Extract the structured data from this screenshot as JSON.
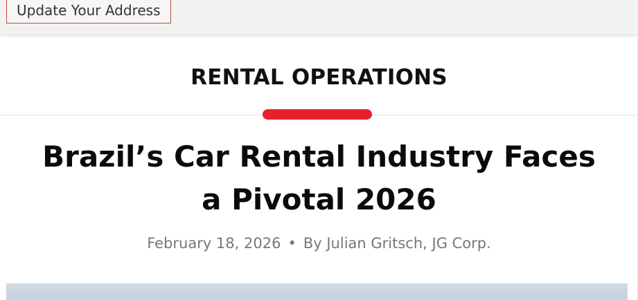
{
  "top_bar": {
    "update_address_label": "Update Your Address"
  },
  "article": {
    "category": "RENTAL OPERATIONS",
    "headline": "Brazil’s Car Rental Industry Faces a Pivotal 2026",
    "date": "February 18, 2026",
    "separator": "•",
    "byline": "By Julian Gritsch, JG Corp."
  },
  "colors": {
    "accent": "#e8202c",
    "button_border": "#c9473a",
    "meta_text": "#777777"
  }
}
